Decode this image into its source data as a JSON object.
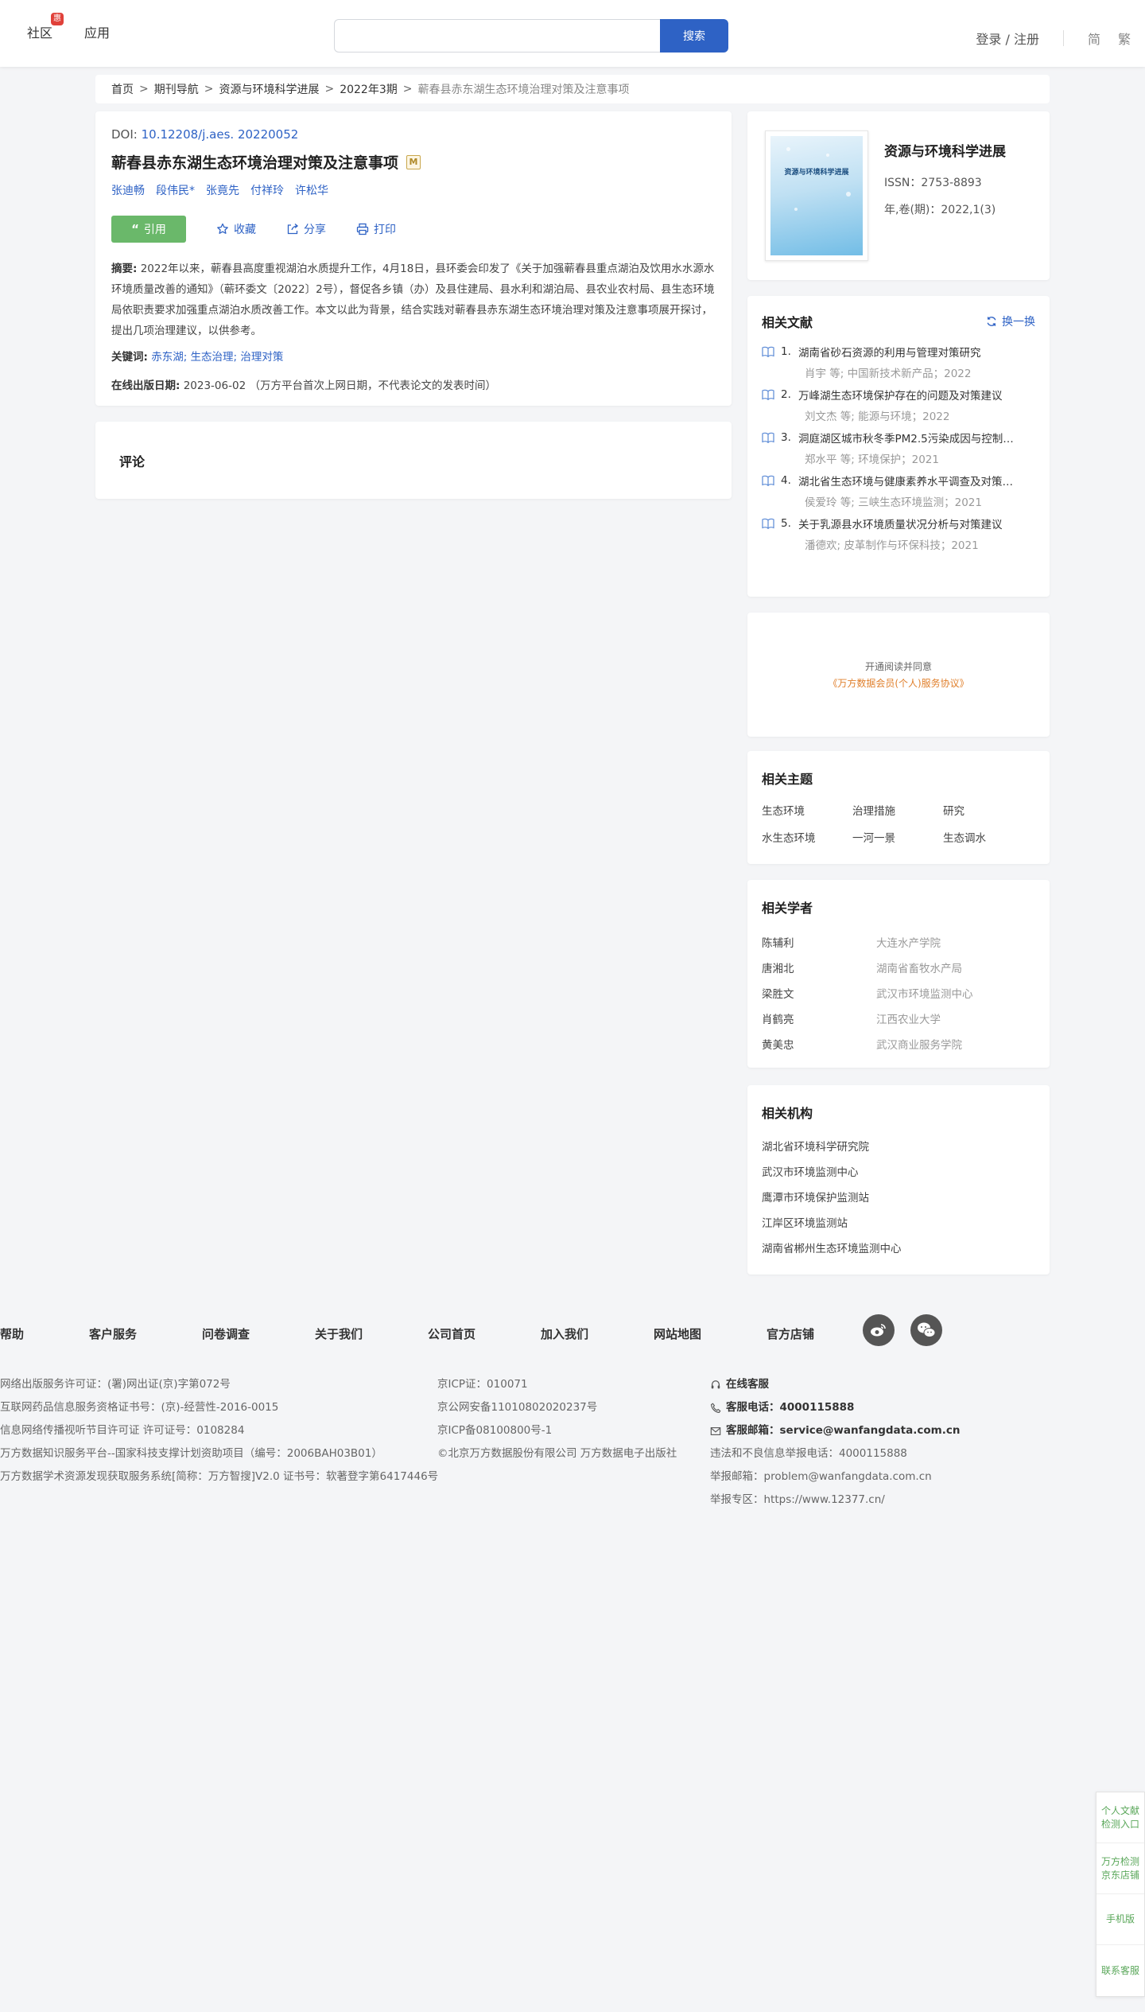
{
  "header": {
    "nav": [
      "社区",
      "应用"
    ],
    "community_badge": "惠",
    "search_placeholder": "",
    "search_button": "搜索",
    "login": "登录 / 注册",
    "lang_simplified": "简",
    "lang_traditional": "繁"
  },
  "breadcrumb": [
    "首页",
    "期刊导航",
    "资源与环境科学进展",
    "2022年3期",
    "蕲春县赤东湖生态环境治理对策及注意事项"
  ],
  "breadcrumb_sep": ">",
  "article": {
    "doi_label": "DOI: ",
    "doi_value": "10.12208/j.aes. 20220052",
    "title": "蕲春县赤东湖生态环境治理对策及注意事项",
    "m_badge": "M",
    "authors": [
      "张迪畅",
      "段伟民*",
      "张竟先",
      "付祥玲",
      "许松华"
    ],
    "actions": {
      "cite": "引用",
      "favorite": "收藏",
      "share": "分享",
      "print": "打印"
    },
    "abstract_label": "摘要:",
    "abstract": "2022年以来，蕲春县高度重视湖泊水质提升工作，4月18日，县环委会印发了《关于加强蕲春县重点湖泊及饮用水水源水环境质量改善的通知》（蕲环委文〔2022〕2号），督促各乡镇（办）及县住建局、县水利和湖泊局、县农业农村局、县生态环境局依职责要求加强重点湖泊水质改善工作。本文以此为背景，结合实践对蕲春县赤东湖生态环境治理对策及注意事项展开探讨，提出几项治理建议，以供参考。",
    "keywords_label": "关键词:",
    "keywords": "赤东湖; 生态治理; 治理对策",
    "pubdate_label": "在线出版日期:",
    "pubdate": "2023-06-02 （万方平台首次上网日期，不代表论文的发表时间）"
  },
  "comment": {
    "title": "评论"
  },
  "journal": {
    "cover_text": "资源与环境科学进展",
    "name": "资源与环境科学进展",
    "issn": "ISSN：2753-8893",
    "volume": "年,卷(期)：2022,1(3)"
  },
  "related_docs": {
    "title": "相关文献",
    "refresh": "换一换",
    "items": [
      {
        "num": "1.",
        "title": "湖南省砂石资源的利用与管理对策研究",
        "meta": "肖宇  等;  中国新技术新产品；2022"
      },
      {
        "num": "2.",
        "title": "万峰湖生态环境保护存在的问题及对策建议",
        "meta": "刘文杰  等;  能源与环境；2022"
      },
      {
        "num": "3.",
        "title": "洞庭湖区城市秋冬季PM2.5污染成因与控制…",
        "meta": "郑水平  等;  环境保护；2021"
      },
      {
        "num": "4.",
        "title": "湖北省生态环境与健康素养水平调查及对策…",
        "meta": "侯爱玲  等;  三峡生态环境监测；2021"
      },
      {
        "num": "5.",
        "title": "关于乳源县水环境质量状况分析与对策建议",
        "meta": "潘德欢;  皮革制作与环保科技；2021"
      }
    ]
  },
  "agreement": {
    "line1": "开通阅读并同意",
    "line2": "《万方数据会员(个人)服务协议》"
  },
  "topics": {
    "title": "相关主题",
    "items": [
      "生态环境",
      "治理措施",
      "研究",
      "水生态环境",
      "一河一景",
      "生态调水"
    ]
  },
  "scholars": {
    "title": "相关学者",
    "items": [
      {
        "name": "陈辅利",
        "org": "大连水产学院"
      },
      {
        "name": "唐湘北",
        "org": "湖南省畜牧水产局"
      },
      {
        "name": "梁胜文",
        "org": "武汉市环境监测中心"
      },
      {
        "name": "肖鹤亮",
        "org": "江西农业大学"
      },
      {
        "name": "黄美忠",
        "org": "武汉商业服务学院"
      }
    ]
  },
  "orgs": {
    "title": "相关机构",
    "items": [
      "湖北省环境科学研究院",
      "武汉市环境监测中心",
      "鹰潭市环境保护监测站",
      "江岸区环境监测站",
      "湖南省郴州生态环境监测中心"
    ]
  },
  "footer": {
    "links": [
      "帮助",
      "客户服务",
      "问卷调查",
      "关于我们",
      "公司首页",
      "加入我们",
      "网站地图",
      "官方店铺"
    ],
    "col1": [
      "网络出版服务许可证：(署)网出证(京)字第072号",
      "互联网药品信息服务资格证书号：(京)-经营性-2016-0015",
      "信息网络传播视听节目许可证 许可证号：0108284",
      "万方数据知识服务平台--国家科技支撑计划资助项目（编号：2006BAH03B01）",
      "万方数据学术资源发现获取服务系统[简称：万方智搜]V2.0 证书号：软著登字第6417446号"
    ],
    "col2": [
      "京ICP证：010071",
      "京公网安备11010802020237号",
      "京ICP备08100800号-1",
      "©北京万方数据股份有限公司 万方数据电子出版社"
    ],
    "online_service": "在线客服",
    "phone": "客服电话：4000115888",
    "email": "客服邮箱：service@wanfangdata.com.cn",
    "report_phone": "违法和不良信息举报电话：4000115888",
    "report_email": "举报邮箱：problem@wanfangdata.com.cn",
    "report_zone": "举报专区：https://www.12377.cn/"
  },
  "side": [
    "个人文献检测入口",
    "万方检测京东店铺",
    "手机版",
    "联系客服"
  ]
}
